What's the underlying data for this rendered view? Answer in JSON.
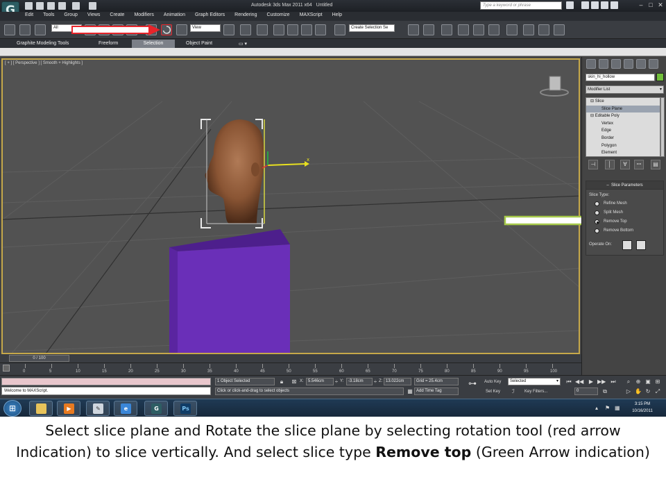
{
  "window": {
    "title": "Autodesk 3ds Max  2011 x64",
    "doc_title": "Untitled",
    "search_placeholder": "Type a keyword or phrase"
  },
  "menu": [
    "Edit",
    "Tools",
    "Group",
    "Views",
    "Create",
    "Modifiers",
    "Animation",
    "Graph Editors",
    "Rendering",
    "Customize",
    "MAXScript",
    "Help"
  ],
  "toolbar": {
    "selection_filter": "All",
    "ref_coord": "View",
    "selection_set": "Create Selection Se"
  },
  "ribbon": {
    "tabs": [
      "Graphite Modeling Tools",
      "Freeform",
      "Selection",
      "Object Paint"
    ],
    "active_tab": "Selection"
  },
  "viewport": {
    "label": "[ + ] [ Perspective ] [ Smooth + Highlights ]",
    "box_color": "#6a2fb8",
    "box_top_color": "#4d1f8c"
  },
  "command_panel": {
    "object_name": "skin_hi_hollow",
    "modifier_list": "Modifier List",
    "stack": [
      {
        "label": "Slice",
        "level": 0
      },
      {
        "label": "Slice Plane",
        "level": 1,
        "selected": true
      },
      {
        "label": "Editable Poly",
        "level": 0
      },
      {
        "label": "Vertex",
        "level": 1
      },
      {
        "label": "Edge",
        "level": 1
      },
      {
        "label": "Border",
        "level": 1
      },
      {
        "label": "Polygon",
        "level": 1
      },
      {
        "label": "Element",
        "level": 1
      }
    ],
    "rollout_title": "Slice Parameters",
    "slice_type_label": "Slice Type:",
    "slice_types": [
      {
        "label": "Refine Mesh",
        "selected": false
      },
      {
        "label": "Split Mesh",
        "selected": false
      },
      {
        "label": "Remove Top",
        "selected": true
      },
      {
        "label": "Remove Bottom",
        "selected": false
      }
    ],
    "operate_on_label": "Operate On:"
  },
  "timeline": {
    "frame_label": "0 / 100",
    "ticks": [
      "0",
      "5",
      "10",
      "15",
      "20",
      "25",
      "30",
      "35",
      "40",
      "45",
      "50",
      "55",
      "60",
      "65",
      "70",
      "75",
      "80",
      "85",
      "90",
      "95",
      "100"
    ]
  },
  "status": {
    "maxscript_output": "Welcome to MAXScript.",
    "selection": "1 Object Selected",
    "prompt": "Click or click-and-drag to select objects",
    "x_label": "X:",
    "x_value": "5.546cm",
    "y_label": "Y:",
    "y_value": "-3.18cm",
    "z_label": "Z:",
    "z_value": "13.022cm",
    "grid": "Grid = 25.4cm",
    "add_time_tag": "Add Time Tag",
    "auto_key": "Auto Key",
    "auto_key_mode": "Selected",
    "set_key": "Set Key",
    "key_filters": "Key Filters...",
    "current_frame": "0"
  },
  "taskbar": {
    "time": "3:15 PM",
    "date": "10/16/2011",
    "apps": [
      "explorer",
      "media-player",
      "notepad",
      "internet-explorer",
      "3ds-max",
      "photoshop"
    ]
  },
  "caption": {
    "line1_part1": "Select slice plane and Rotate the slice plane by selecting rotation tool (red arrow Indication) to slice vertically. And select slice type ",
    "bold": "Remove top",
    "line1_part2": " (Green Arrow indication)"
  },
  "annotations": {
    "red_arrow_color": "#e8242a",
    "green_arrow_color": "#a6c94a"
  }
}
